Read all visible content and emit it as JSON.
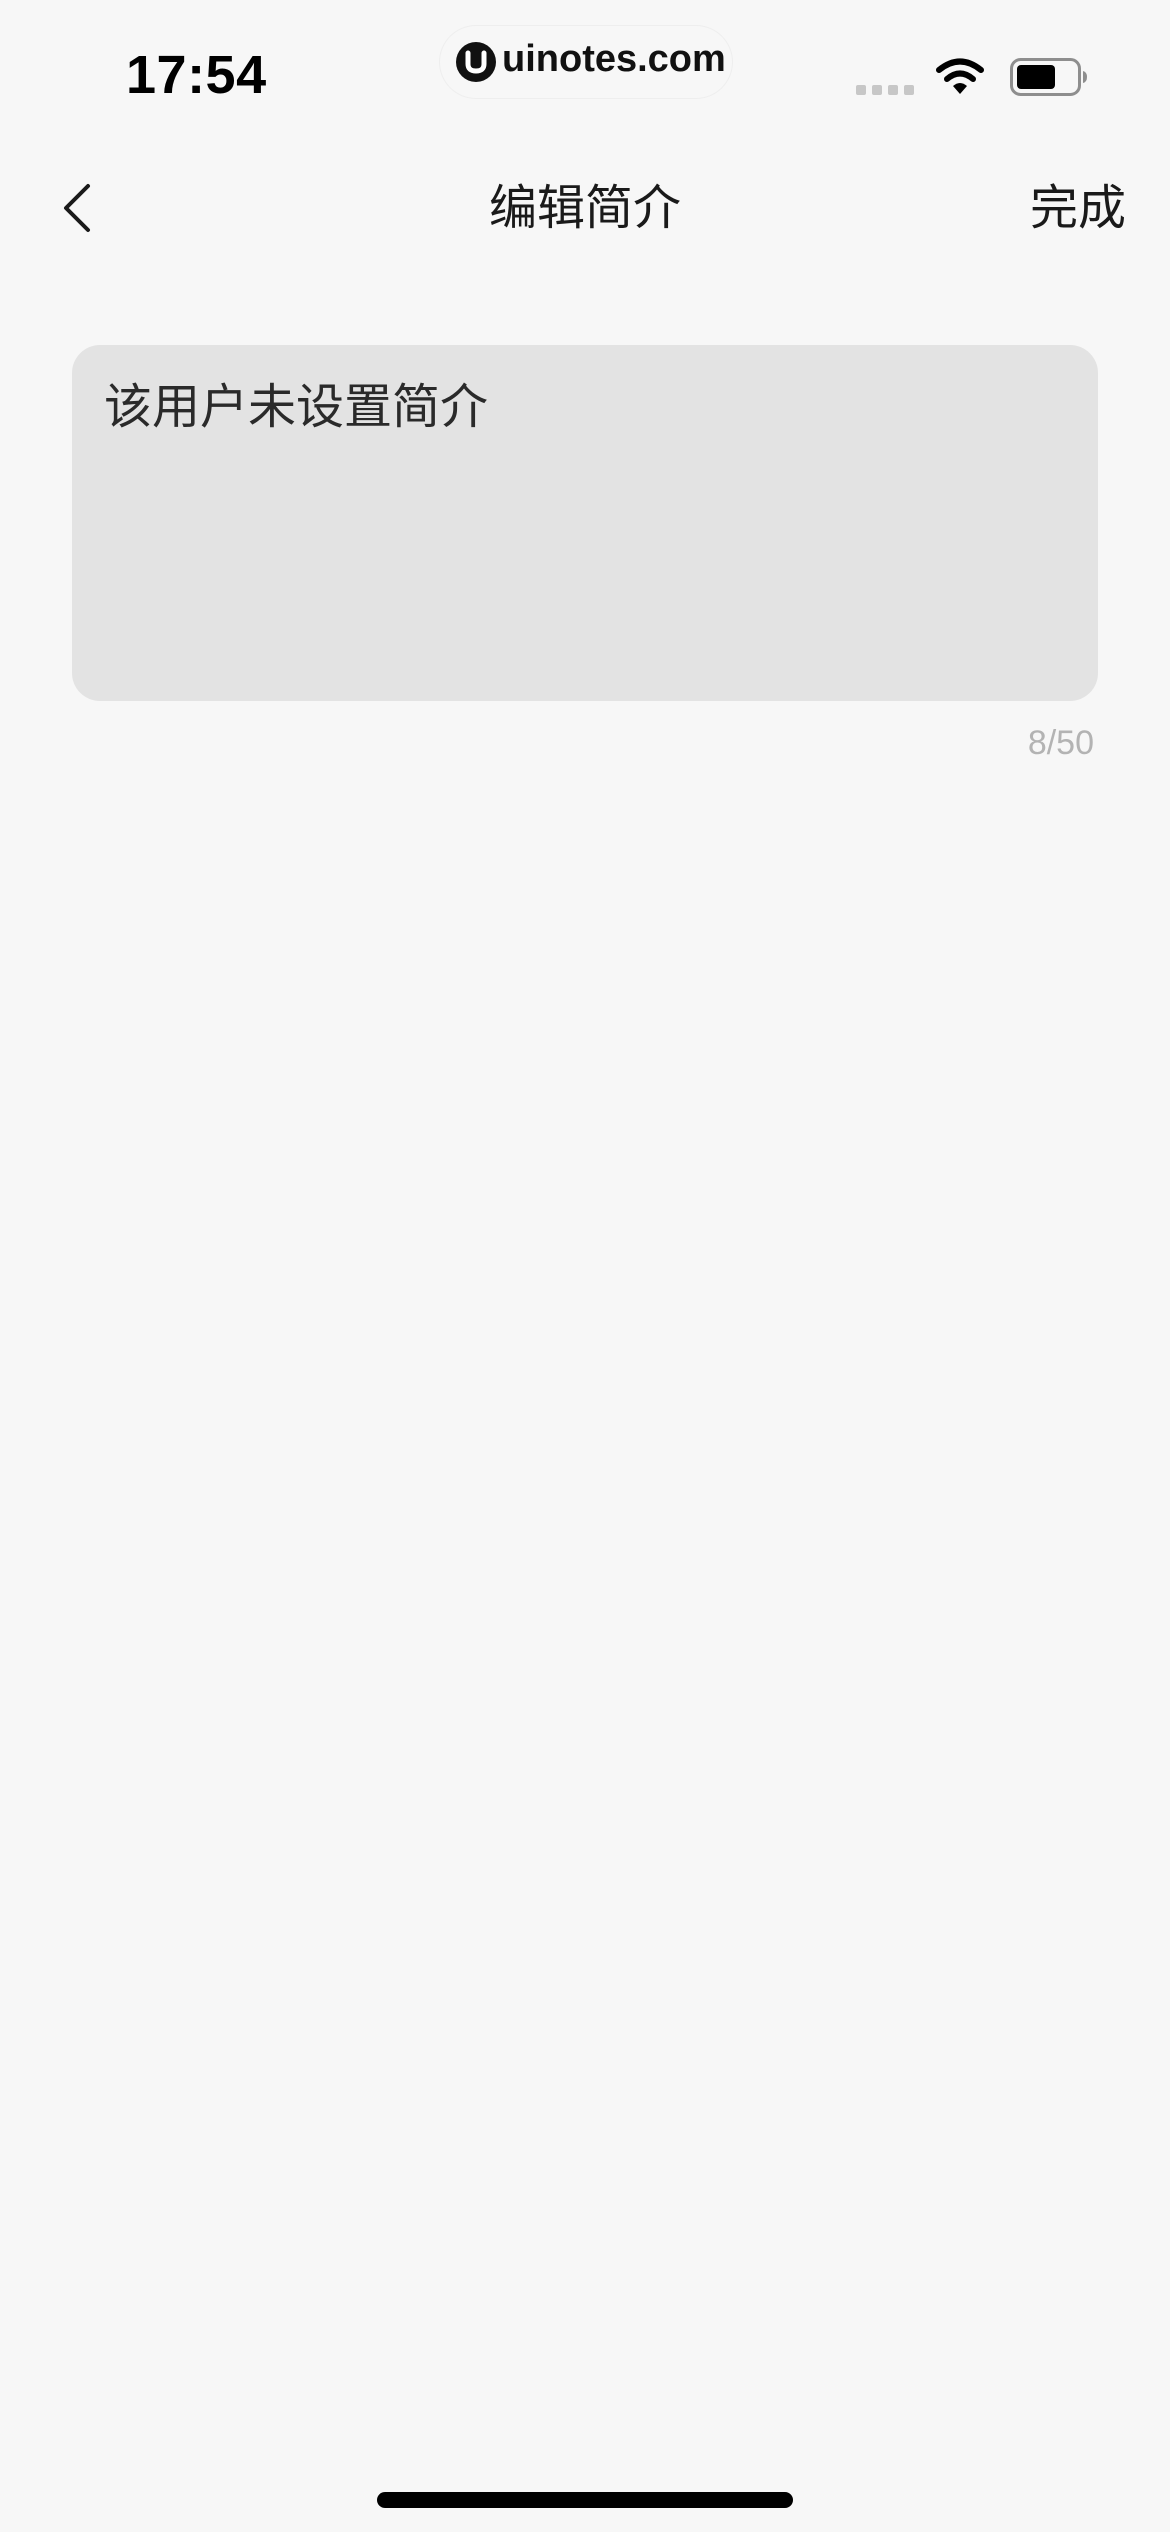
{
  "status_bar": {
    "time": "17:54",
    "watermark": "uinotes.com"
  },
  "nav": {
    "title": "编辑简介",
    "done_label": "完成",
    "back_icon": "chevron-left-icon"
  },
  "bio_editor": {
    "value": "该用户未设置简介",
    "char_count": "8/50"
  },
  "colors": {
    "background": "#f7f7f7",
    "input_background": "#e3e3e3",
    "counter_text": "#b3b3b3"
  }
}
